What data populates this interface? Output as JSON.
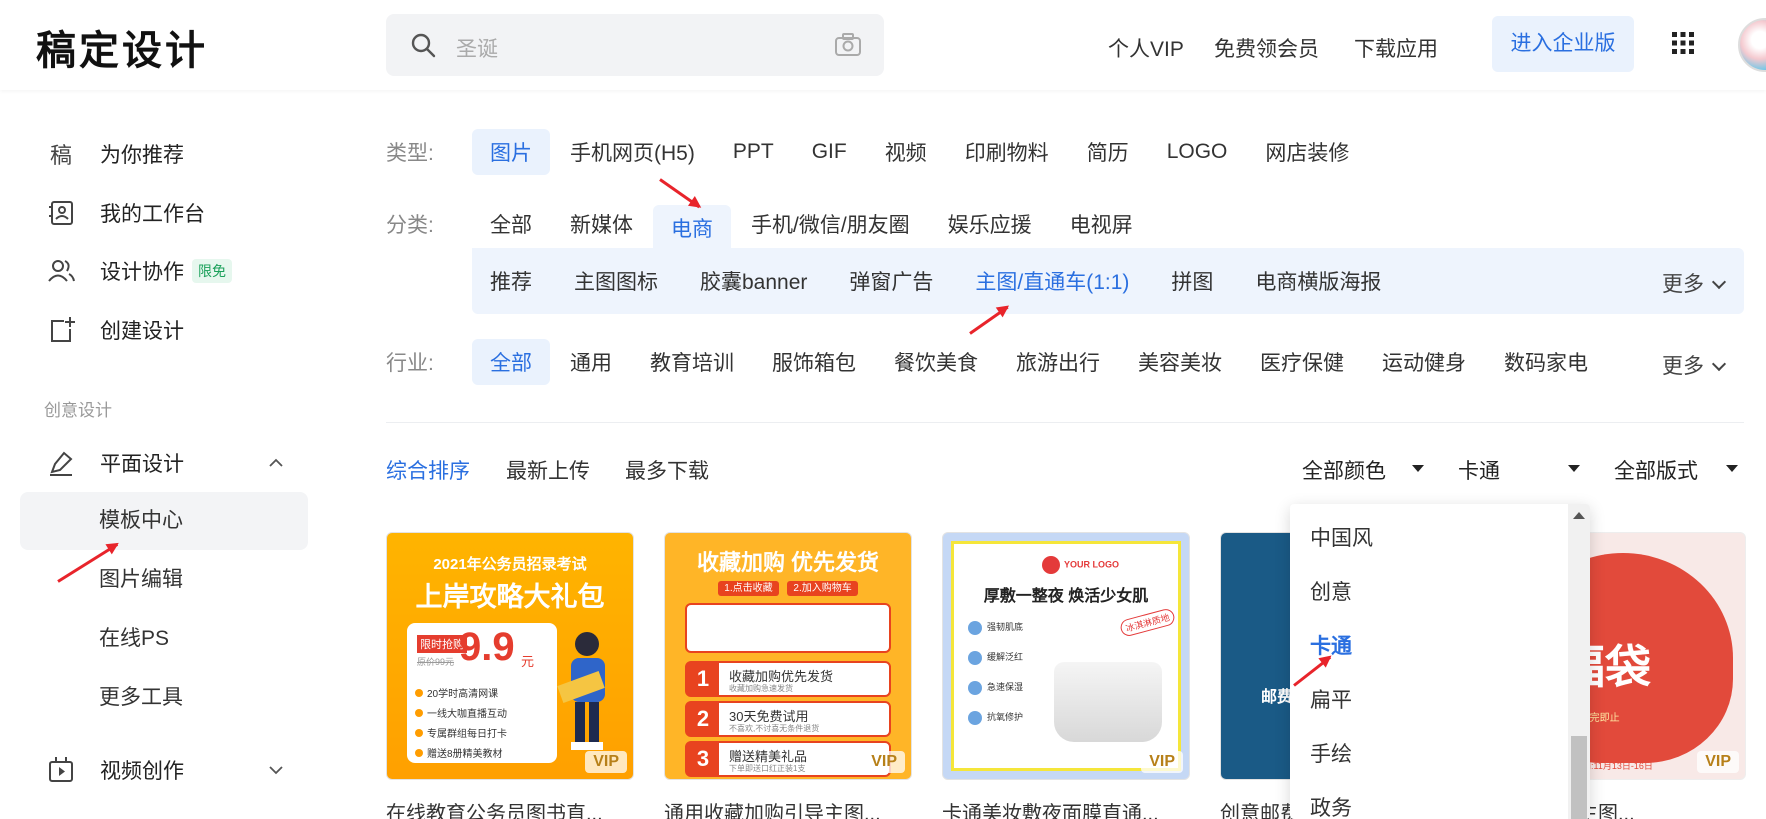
{
  "header": {
    "logo": "稿定设计",
    "search_placeholder": "圣诞",
    "nav": [
      "个人VIP",
      "免费领会员",
      "下载应用"
    ],
    "enterprise_button": "进入企业版"
  },
  "sidebar": {
    "items": [
      {
        "label": "为你推荐",
        "icon": "gaoding-icon"
      },
      {
        "label": "我的工作台",
        "icon": "workspace-icon"
      },
      {
        "label": "设计协作",
        "icon": "users-icon",
        "badge": "限免"
      },
      {
        "label": "创建设计",
        "icon": "create-icon"
      }
    ],
    "section_label": "创意设计",
    "group_label": "平面设计",
    "sub_items": [
      "模板中心",
      "图片编辑",
      "在线PS",
      "更多工具"
    ],
    "video_label": "视频创作"
  },
  "filters": {
    "type_title": "类型:",
    "types": [
      "图片",
      "手机网页(H5)",
      "PPT",
      "GIF",
      "视频",
      "印刷物料",
      "简历",
      "LOGO",
      "网店装修"
    ],
    "category_title": "分类:",
    "categories": [
      "全部",
      "新媒体",
      "电商",
      "手机/微信/朋友圈",
      "娱乐应援",
      "电视屏"
    ],
    "subcategories": [
      "推荐",
      "主图图标",
      "胶囊banner",
      "弹窗广告",
      "主图/直通车(1:1)",
      "拼图",
      "电商横版海报"
    ],
    "more": "更多",
    "industry_title": "行业:",
    "industries": [
      "全部",
      "通用",
      "教育培训",
      "服饰箱包",
      "餐饮美食",
      "旅游出行",
      "美容美妆",
      "医疗保健",
      "运动健身",
      "数码家电"
    ]
  },
  "sort": {
    "options": [
      "综合排序",
      "最新上传",
      "最多下载"
    ],
    "color_select": "全部颜色",
    "style_select": "卡通",
    "layout_select": "全部版式"
  },
  "style_dropdown": {
    "options": [
      "中国风",
      "创意",
      "卡通",
      "扁平",
      "手绘",
      "政务"
    ],
    "selected": "卡通"
  },
  "cards": [
    {
      "title": "在线教育公务员图书直...",
      "vip": "VIP",
      "line1": "2021年公务员招录考试",
      "line2": "上岸攻略大礼包",
      "tag": "限时抢购",
      "price": "9.9",
      "unit": "元",
      "old": "原价99元",
      "bullets": [
        "20学时高清网课",
        "一线大咖直播互动",
        "专属群组每日打卡",
        "赠送8册精美教材"
      ]
    },
    {
      "title": "通用收藏加购引导主图...",
      "vip": "VIP",
      "headline": "收藏加购 优先发货",
      "tags": [
        "1.点击收藏",
        "2.加入购物车"
      ],
      "rows": [
        {
          "n": "1",
          "t": "收藏加购优先发货",
          "s": "收藏加购急速发货"
        },
        {
          "n": "2",
          "t": "30天免费试用",
          "s": "不喜欢,不讨喜无条件退货"
        },
        {
          "n": "3",
          "t": "赠送精美礼品",
          "s": "下单即送口红正装1支"
        }
      ]
    },
    {
      "title": "卡通美妆敷夜面膜直通...",
      "vip": "VIP",
      "logo": "YOUR LOGO",
      "headline": "厚敷一整夜 焕活少女肌",
      "stamp": "冰淇淋质地",
      "features": [
        "强韧肌底",
        "缓解泛红",
        "急速保湿",
        "抗氧修护"
      ]
    },
    {
      "title": "创意邮费...",
      "vip": "",
      "text": "邮费"
    },
    {
      "title": "福袋活动主图...",
      "vip": "VIP",
      "word": "福袋",
      "sub": "(限量)抢完即止",
      "date": "活动时间:11月13日-16日"
    }
  ],
  "colors": {
    "accent": "#2a6fe0",
    "accent_bg": "#eaf2fd",
    "annotation_red": "#e8242b"
  }
}
